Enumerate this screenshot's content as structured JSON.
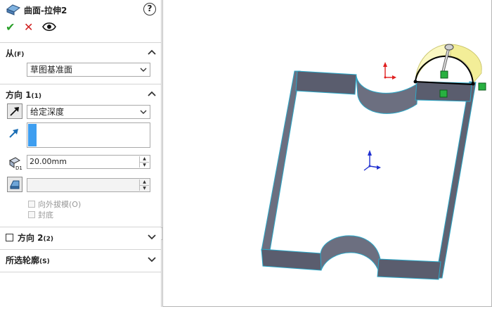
{
  "feature": {
    "title": "曲面-拉伸2",
    "help": "?"
  },
  "actions": {
    "ok": "✔",
    "cancel": "✕",
    "preview": "👁"
  },
  "from": {
    "label": "从",
    "shortcut": "(F)",
    "value": "草图基准面"
  },
  "direction1": {
    "label": "方向 1",
    "shortcut": "(1)",
    "end_condition": "给定深度",
    "depth": "20.00mm",
    "draft_outward": "向外拔模(O)",
    "cap_end": "封底",
    "draft_outward_checked": false,
    "cap_end_checked": false
  },
  "direction2": {
    "label": "方向 2",
    "shortcut": "(2)",
    "checked": false
  },
  "selected_contours": {
    "label": "所选轮廓",
    "shortcut": "(S)"
  },
  "colors": {
    "accent_blue": "#3e9ef0",
    "extrude_preview": "#fbf8c0",
    "wall_face": "#6c6f80",
    "wall_edge": "#2ca8c8",
    "ok_green": "#2aa02a",
    "cancel_red": "#d02020"
  }
}
